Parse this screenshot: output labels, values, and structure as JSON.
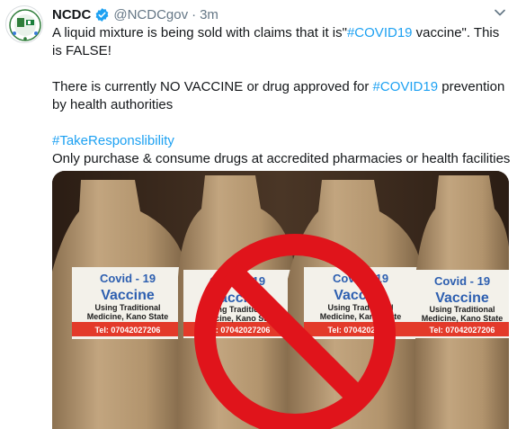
{
  "tweet": {
    "display_name": "NCDC",
    "handle": "@NCDCgov",
    "separator": "·",
    "timestamp": "3m",
    "line1_pre": "A liquid mixture is being sold with claims that it is\"",
    "line1_tag": "#COVID19",
    "line1_post": " vaccine\". This is FALSE!",
    "line2_pre": "There is currently NO VACCINE or drug approved for ",
    "line2_tag": "#COVID19",
    "line2_post": " prevention by health authorities",
    "line3_tag": "#TakeResponslibility",
    "line4": "Only purchase & consume drugs at accredited pharmacies or health facilities"
  },
  "avatar_logo_text": "NCDC",
  "bottle_labels": {
    "brand": "Covid - 19",
    "title": "Vaccine",
    "line1": "Using Traditional",
    "line2": "Medicine, Kano State",
    "phone": "Tel: 07042027206"
  },
  "colors": {
    "link": "#1da1f2",
    "verified": "#1da1f2",
    "muted": "#657786",
    "prohibition": "#e0141b"
  },
  "icons": [
    "verified-badge-icon",
    "chevron-down-icon",
    "prohibition-sign-icon"
  ]
}
